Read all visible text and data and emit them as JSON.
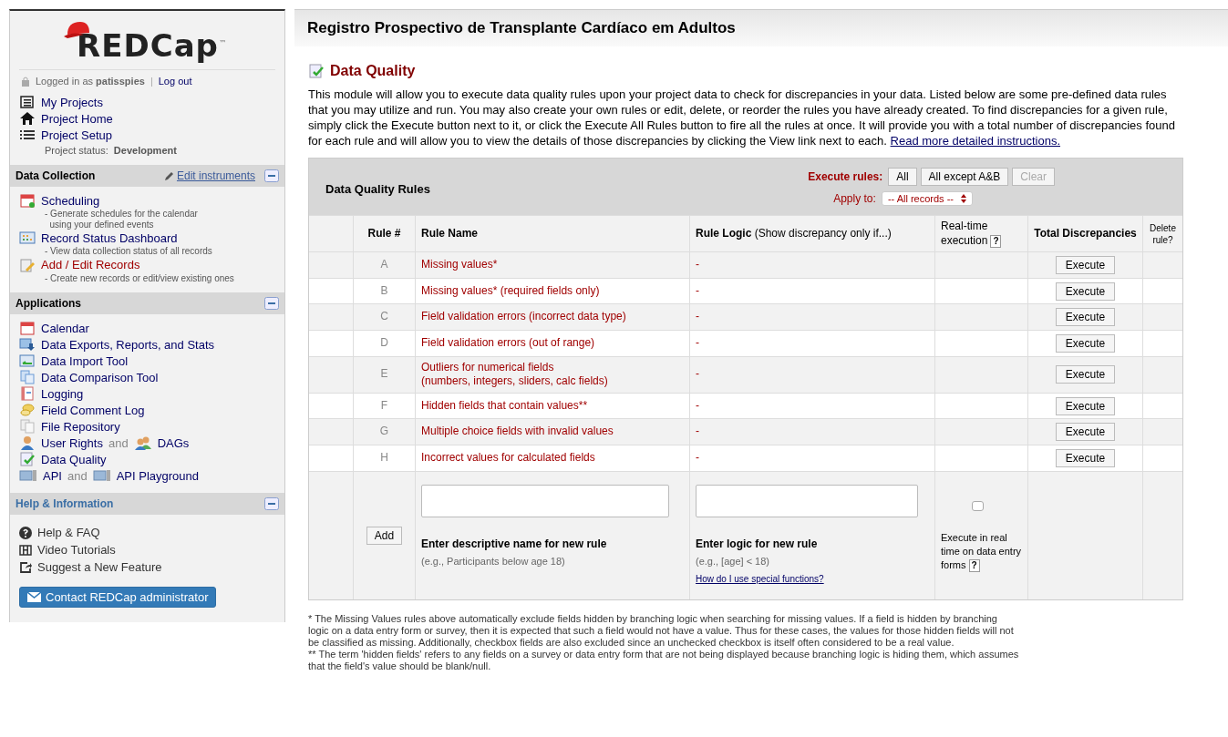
{
  "sidebar": {
    "logo": "REDCap",
    "logo_mark": "™",
    "login": {
      "prefix": "Logged in as",
      "user": "patisspies",
      "separator": "|",
      "logout": "Log out"
    },
    "project_links": [
      {
        "label": "My Projects"
      },
      {
        "label": "Project Home"
      },
      {
        "label": "Project Setup"
      }
    ],
    "project_status": {
      "label": "Project status:",
      "value": "Development"
    },
    "sections": [
      {
        "title": "Data Collection",
        "action": "Edit instruments",
        "expanded": true,
        "items": [
          {
            "parts": [
              {
                "text": "Scheduling",
                "kind": "link"
              }
            ],
            "description": "- Generate schedules for the calendar\n  using your defined events",
            "emphasized": false
          },
          {
            "parts": [
              {
                "text": "Record Status Dashboard",
                "kind": "link"
              }
            ],
            "description": "- View data collection status of all records",
            "emphasized": false
          },
          {
            "parts": [
              {
                "text": "Add / Edit Records",
                "kind": "link"
              }
            ],
            "description": "- Create new records or edit/view existing ones",
            "emphasized": true
          }
        ]
      },
      {
        "title": "Applications",
        "expanded": true,
        "items": [
          {
            "parts": [
              {
                "text": "Calendar",
                "kind": "link"
              }
            ]
          },
          {
            "parts": [
              {
                "text": "Data Exports, Reports, and Stats",
                "kind": "link"
              }
            ]
          },
          {
            "parts": [
              {
                "text": "Data Import Tool",
                "kind": "link"
              }
            ]
          },
          {
            "parts": [
              {
                "text": "Data Comparison Tool",
                "kind": "link"
              }
            ]
          },
          {
            "parts": [
              {
                "text": "Logging",
                "kind": "link"
              }
            ]
          },
          {
            "parts": [
              {
                "text": "Field Comment Log",
                "kind": "link"
              }
            ]
          },
          {
            "parts": [
              {
                "text": "File Repository",
                "kind": "link"
              }
            ]
          },
          {
            "parts": [
              {
                "text": "User Rights",
                "kind": "link"
              },
              {
                "text": "and",
                "kind": "plain"
              },
              {
                "text": "DAGs",
                "kind": "link"
              }
            ]
          },
          {
            "parts": [
              {
                "text": "Data Quality",
                "kind": "link"
              }
            ]
          },
          {
            "parts": [
              {
                "text": "API",
                "kind": "link"
              },
              {
                "text": "and",
                "kind": "plain"
              },
              {
                "text": "API Playground",
                "kind": "link"
              }
            ]
          }
        ]
      },
      {
        "title": "Help & Information",
        "expanded": true,
        "items": [
          {
            "parts": [
              {
                "text": "Help & FAQ",
                "kind": "help"
              }
            ]
          },
          {
            "parts": [
              {
                "text": "Video Tutorials",
                "kind": "help"
              }
            ]
          },
          {
            "parts": [
              {
                "text": "Suggest a New Feature",
                "kind": "help"
              }
            ]
          }
        ],
        "button": "Contact REDCap administrator"
      }
    ]
  },
  "header": {
    "title": "Registro Prospectivo de Transplante Cardíaco em Adultos"
  },
  "page": {
    "title": "Data Quality",
    "intro": "This module will allow you to execute data quality rules upon your project data to check for discrepancies in your data. Listed below are some pre-defined data rules that you may utilize and run. You may also create your own rules or edit, delete, or reorder the rules you have already created. To find discrepancies for a given rule, simply click the Execute button next to it, or click the Execute All Rules button to fire all the rules at once. It will provide you with a total number of discrepancies found for each rule and will allow you to view the details of those discrepancies by clicking the View link next to each.",
    "intro_link": "Read more detailed instructions."
  },
  "rules_table": {
    "title": "Data Quality Rules",
    "execute_label": "Execute rules:",
    "execute_buttons": [
      {
        "label": "All",
        "disabled": false
      },
      {
        "label": "All except A&B",
        "disabled": false
      },
      {
        "label": "Clear",
        "disabled": true
      }
    ],
    "apply_label": "Apply to:",
    "apply_value": "-- All records --",
    "columns": [
      {
        "label": "Rule #"
      },
      {
        "label": "Rule Name"
      },
      {
        "label": "Rule Logic",
        "note": "(Show discrepancy only if...)"
      },
      {
        "label": "Real-time execution",
        "help": "?"
      },
      {
        "label": "Total Discrepancies"
      },
      {
        "label": "Delete rule?"
      }
    ],
    "rows": [
      {
        "rule": "A",
        "name": "Missing values*",
        "logic": "-",
        "action": "Execute"
      },
      {
        "rule": "B",
        "name": "Missing values* (required fields only)",
        "logic": "-",
        "action": "Execute"
      },
      {
        "rule": "C",
        "name": "Field validation errors (incorrect data type)",
        "logic": "-",
        "action": "Execute"
      },
      {
        "rule": "D",
        "name": "Field validation errors (out of range)",
        "logic": "-",
        "action": "Execute"
      },
      {
        "rule": "E",
        "name": "Outliers for numerical fields\n(numbers, integers, sliders, calc fields)",
        "logic": "-",
        "action": "Execute"
      },
      {
        "rule": "F",
        "name": "Hidden fields that contain values**",
        "logic": "-",
        "action": "Execute"
      },
      {
        "rule": "G",
        "name": "Multiple choice fields with invalid values",
        "logic": "-",
        "action": "Execute"
      },
      {
        "rule": "H",
        "name": "Incorrect values for calculated fields",
        "logic": "-",
        "action": "Execute"
      }
    ],
    "new_rule": {
      "add": "Add",
      "name_label": "Enter descriptive name for new rule",
      "name_example": "(e.g., Participants below age 18)",
      "logic_label": "Enter logic for new rule",
      "logic_example": "(e.g., [age] < 18)",
      "logic_link": "How do I use special functions?",
      "realtime_checked": false,
      "realtime_label": "Execute in real time on data entry forms",
      "realtime_help": "?"
    }
  },
  "footnotes": [
    "* The Missing Values rules above automatically exclude fields hidden by branching logic when searching for missing values. If a field is hidden by branching logic on a data entry form or survey, then it is expected that such a field would not have a value. Thus for these cases, the values for those hidden fields will not be classified as missing. Additionally, checkbox fields are also excluded since an unchecked checkbox is itself often considered to be a real value.",
    "** The term 'hidden fields' refers to any fields on a survey or data entry form that are not being displayed because branching logic is hiding them, which assumes that the field's value should be blank/null."
  ]
}
